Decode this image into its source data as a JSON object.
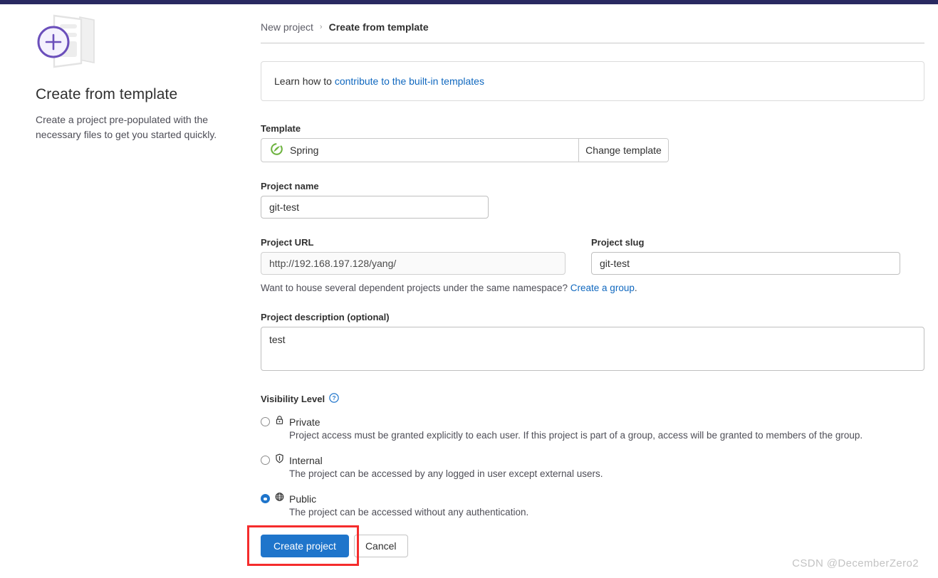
{
  "intro": {
    "title": "Create from template",
    "description": "Create a project pre-populated with the necessary files to get you started quickly.",
    "illustration_icon": "plus-in-circle-document-icon"
  },
  "breadcrumb": {
    "parent": "New project",
    "separator": "›",
    "current": "Create from template"
  },
  "notice": {
    "prefix": "Learn how to ",
    "link": "contribute to the built-in templates"
  },
  "form": {
    "template": {
      "label": "Template",
      "selected": "Spring",
      "icon": "spring-leaf-icon",
      "change_button": "Change template"
    },
    "project_name": {
      "label": "Project name",
      "value": "git-test"
    },
    "project_url": {
      "label": "Project URL",
      "value": "http://192.168.197.128/yang/"
    },
    "project_slug": {
      "label": "Project slug",
      "value": "git-test"
    },
    "namespace_hint": {
      "text": "Want to house several dependent projects under the same namespace? ",
      "link": "Create a group",
      "suffix": "."
    },
    "description": {
      "label": "Project description (optional)",
      "value": "test"
    },
    "visibility": {
      "label": "Visibility Level",
      "help_icon": "question-circle-icon",
      "options": [
        {
          "id": "private",
          "name": "Private",
          "icon": "lock-icon",
          "selected": false,
          "description": "Project access must be granted explicitly to each user. If this project is part of a group, access will be granted to members of the group."
        },
        {
          "id": "internal",
          "name": "Internal",
          "icon": "shield-icon",
          "selected": false,
          "description": "The project can be accessed by any logged in user except external users."
        },
        {
          "id": "public",
          "name": "Public",
          "icon": "globe-icon",
          "selected": true,
          "description": "The project can be accessed without any authentication."
        }
      ]
    },
    "actions": {
      "submit": "Create project",
      "cancel": "Cancel"
    }
  },
  "watermark": "CSDN @DecemberZero2",
  "colors": {
    "primary": "#1f75cb",
    "link": "#1068bf",
    "annotation": "#f52c2c",
    "topbar": "#292961",
    "accent_purple": "#6b4fbb",
    "spring_green": "#6db33f"
  }
}
